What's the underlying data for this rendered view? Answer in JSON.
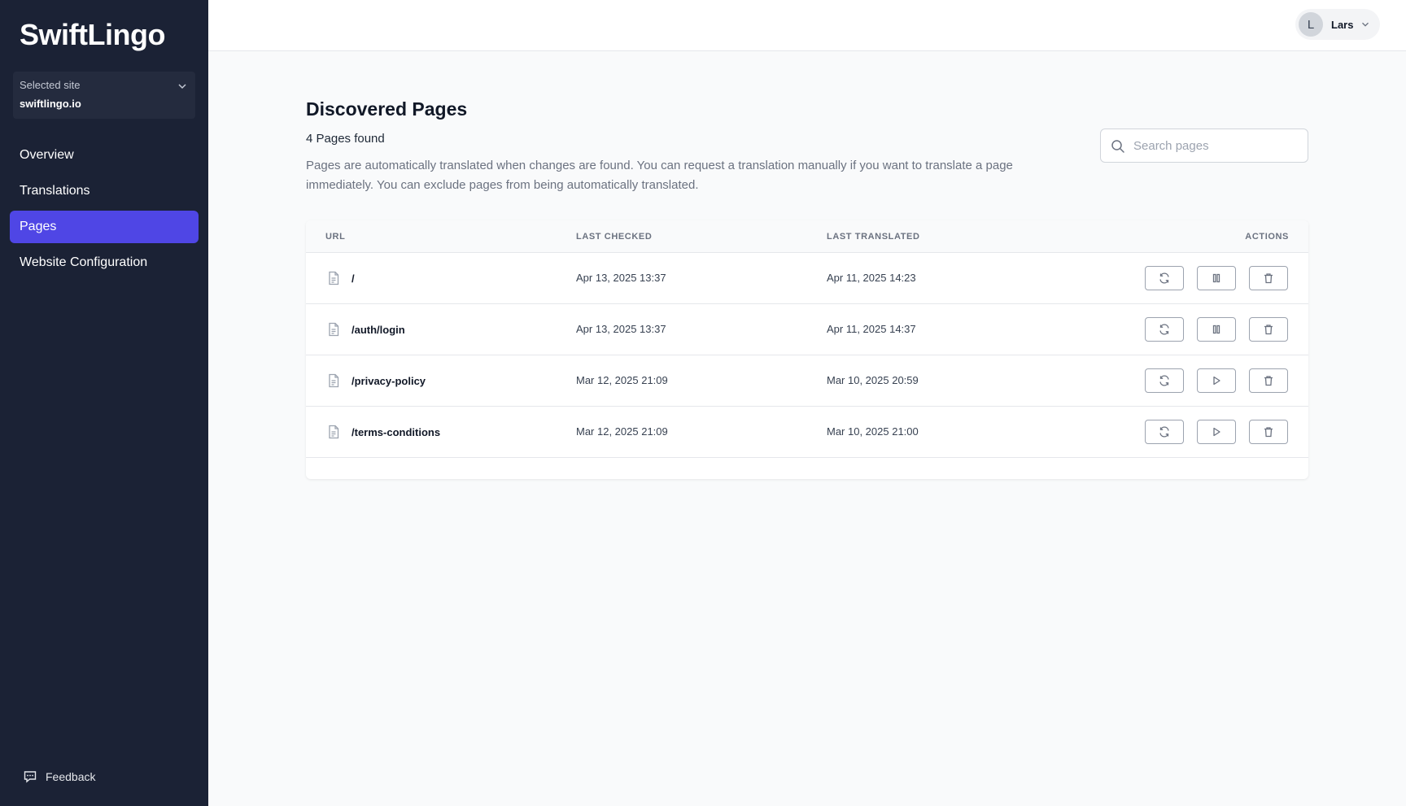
{
  "app": {
    "name": "SwiftLingo"
  },
  "site_selector": {
    "label": "Selected site",
    "value": "swiftlingo.io"
  },
  "nav": {
    "items": [
      {
        "label": "Overview",
        "active": false
      },
      {
        "label": "Translations",
        "active": false
      },
      {
        "label": "Pages",
        "active": true
      },
      {
        "label": "Website Configuration",
        "active": false
      }
    ]
  },
  "feedback": {
    "label": "Feedback"
  },
  "user": {
    "initial": "L",
    "name": "Lars"
  },
  "main": {
    "title": "Discovered Pages",
    "count": "4 Pages found",
    "description": "Pages are automatically translated when changes are found. You can request a translation manually if you want to translate a page immediately. You can exclude pages from being automatically translated."
  },
  "search": {
    "placeholder": "Search pages",
    "value": ""
  },
  "table": {
    "headers": {
      "url": "URL",
      "last_checked": "LAST CHECKED",
      "last_translated": "LAST TRANSLATED",
      "actions": "ACTIONS"
    },
    "rows": [
      {
        "url": "/",
        "last_checked": "Apr 13, 2025 13:37",
        "last_translated": "Apr 11, 2025 14:23",
        "toggle": "pause"
      },
      {
        "url": "/auth/login",
        "last_checked": "Apr 13, 2025 13:37",
        "last_translated": "Apr 11, 2025 14:37",
        "toggle": "pause"
      },
      {
        "url": "/privacy-policy",
        "last_checked": "Mar 12, 2025 21:09",
        "last_translated": "Mar 10, 2025 20:59",
        "toggle": "play"
      },
      {
        "url": "/terms-conditions",
        "last_checked": "Mar 12, 2025 21:09",
        "last_translated": "Mar 10, 2025 21:00",
        "toggle": "play"
      }
    ],
    "row_actions": [
      "refresh-icon",
      "pause-or-play-icon",
      "trash-icon"
    ]
  },
  "colors": {
    "sidebar_bg": "#1b2235",
    "accent": "#4f46e5",
    "page_bg": "#f9fafb"
  }
}
